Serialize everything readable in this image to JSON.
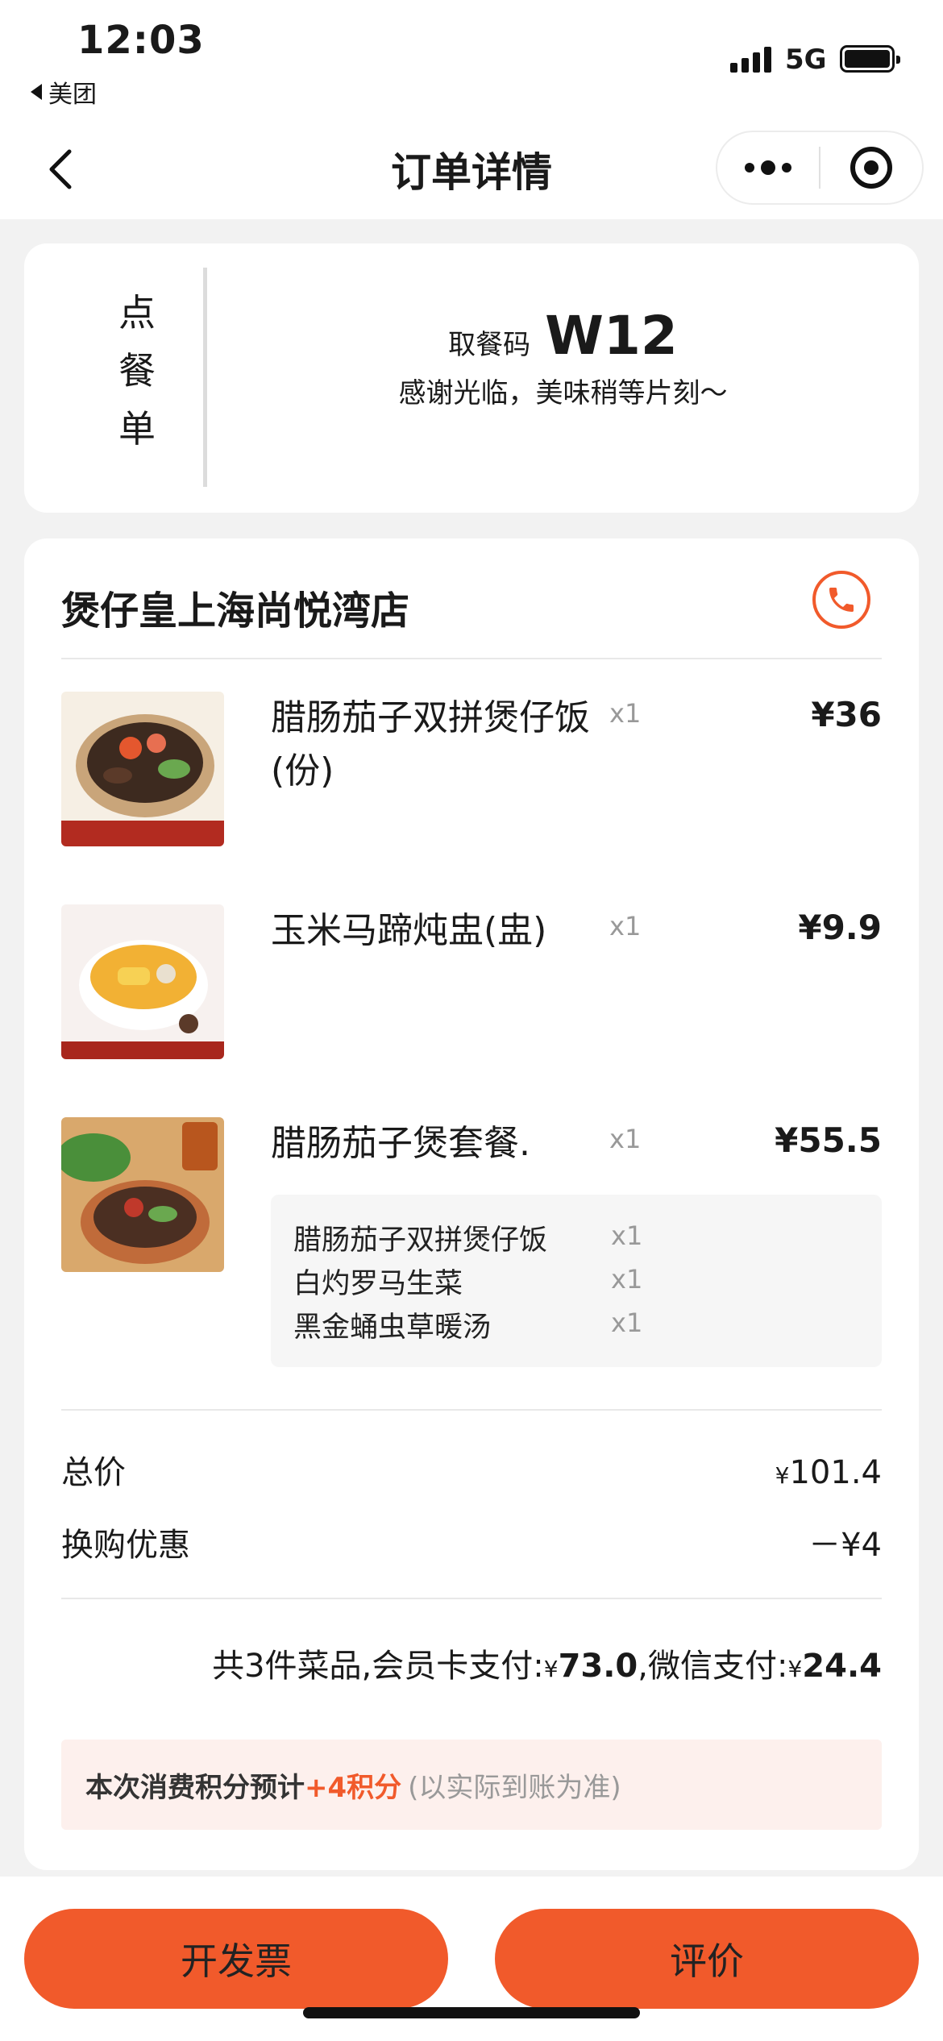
{
  "status_bar": {
    "time": "12:03",
    "back_app": "美团",
    "network": "5G"
  },
  "nav": {
    "title": "订单详情"
  },
  "pickup": {
    "side_label_chars": [
      "点",
      "餐",
      "单"
    ],
    "code_label": "取餐码",
    "code": "W12",
    "message": "感谢光临，美味稍等片刻～"
  },
  "store": {
    "name": "煲仔皇上海尚悦湾店"
  },
  "items": [
    {
      "name": "腊肠茄子双拼煲仔饭(份)",
      "qty": "x1",
      "price": "¥36"
    },
    {
      "name": "玉米马蹄炖盅(盅)",
      "qty": "x1",
      "price": "¥9.9"
    },
    {
      "name": "腊肠茄子煲套餐.",
      "qty": "x1",
      "price": "¥55.5",
      "sub_items": [
        {
          "name": "腊肠茄子双拼煲仔饭",
          "qty": "x1"
        },
        {
          "name": "白灼罗马生菜",
          "qty": "x1"
        },
        {
          "name": "黑金蛹虫草暖汤",
          "qty": "x1"
        }
      ]
    }
  ],
  "summary": {
    "total_label": "总价",
    "total_yen": "¥",
    "total_value": "101.4",
    "discount_label": "换购优惠",
    "discount_value": "－¥4"
  },
  "payment": {
    "prefix": "共3件菜品,会员卡支付:",
    "yen1": "¥",
    "member_amount": "73.0",
    "mid": ",微信支付:",
    "yen2": "¥",
    "wechat_amount": "24.4"
  },
  "points": {
    "prefix": "本次消费积分预计",
    "highlight": "+4积分",
    "note": "(以实际到账为准)"
  },
  "buttons": {
    "invoice": "开发票",
    "review": "评价"
  },
  "colors": {
    "accent": "#f15a2b",
    "points_bg": "#fdf0ed"
  }
}
